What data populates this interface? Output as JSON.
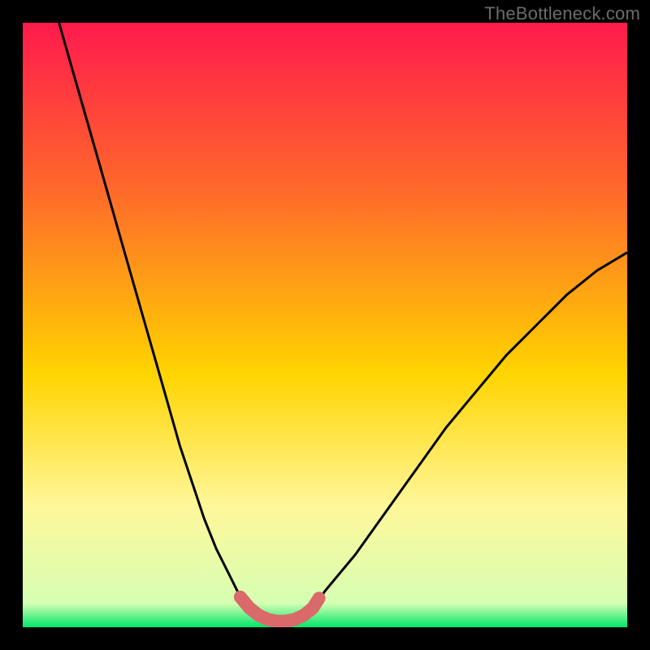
{
  "watermark": "TheBottleneck.com",
  "colors": {
    "bg_black": "#000000",
    "grad_top": "#ff1a4d",
    "grad_upper": "#ff6a2a",
    "grad_mid": "#ffd400",
    "grad_lower": "#fff79a",
    "grad_bottom": "#00e66a",
    "curve_stroke": "#000000",
    "highlight_stroke": "#da6a6a"
  },
  "chart_data": {
    "type": "line",
    "title": "",
    "xlabel": "",
    "ylabel": "",
    "xlim": [
      0,
      100
    ],
    "ylim": [
      0,
      100
    ],
    "series": [
      {
        "name": "bottleneck-curve",
        "x": [
          6,
          8,
          10,
          12,
          14,
          16,
          18,
          20,
          22,
          24,
          26,
          28,
          30,
          32,
          34,
          36,
          38,
          40,
          42,
          44,
          46,
          48,
          50,
          55,
          60,
          65,
          70,
          75,
          80,
          85,
          90,
          95,
          100
        ],
        "y": [
          100,
          93,
          86,
          79,
          72,
          65,
          58,
          51,
          44,
          37,
          30,
          24,
          18,
          13,
          9,
          5,
          3,
          1.5,
          1,
          1,
          1.5,
          3,
          6,
          12,
          19,
          26,
          33,
          39,
          45,
          50,
          55,
          59,
          62
        ]
      }
    ],
    "highlight": {
      "name": "optimal-range",
      "x_range": [
        36,
        49
      ],
      "x": [
        36,
        37.5,
        39,
        40.5,
        42,
        43.5,
        45,
        46.5,
        48,
        49
      ],
      "y": [
        5,
        3.2,
        2,
        1.3,
        1,
        1,
        1.3,
        2,
        3.2,
        4.8
      ]
    },
    "gradient_stops": [
      {
        "offset": 0,
        "color": "#ff1a4d"
      },
      {
        "offset": 28,
        "color": "#ff6a2a"
      },
      {
        "offset": 58,
        "color": "#ffd400"
      },
      {
        "offset": 80,
        "color": "#fff79a"
      },
      {
        "offset": 96,
        "color": "#d6ffb3"
      },
      {
        "offset": 100,
        "color": "#00e66a"
      }
    ]
  }
}
